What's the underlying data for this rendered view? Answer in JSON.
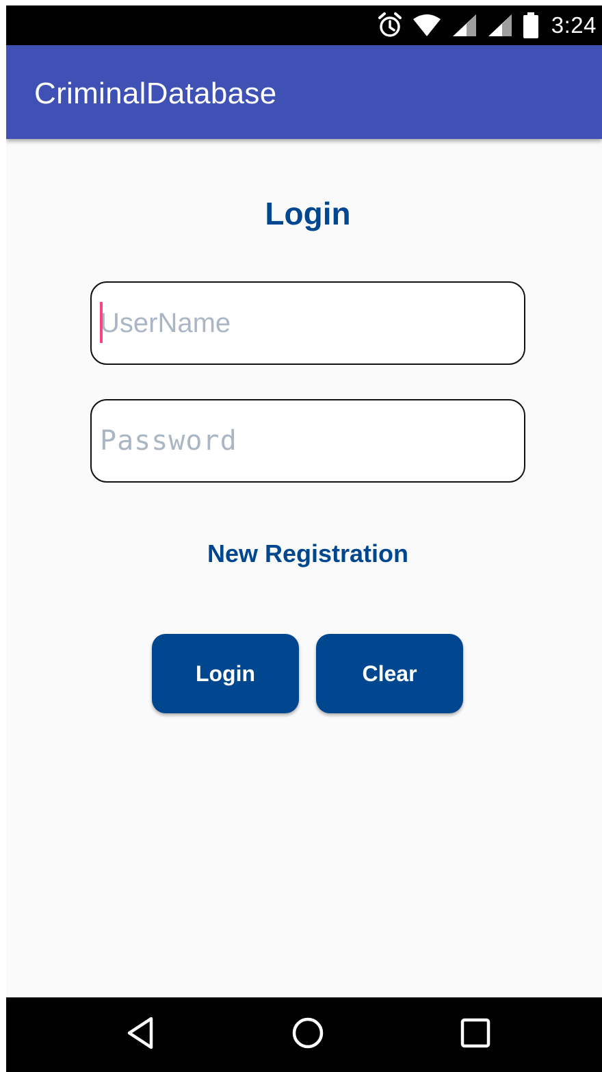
{
  "status_bar": {
    "time": "3:24",
    "icons": [
      "alarm-icon",
      "wifi-icon",
      "signal-icon",
      "signal-icon",
      "battery-icon"
    ]
  },
  "app_bar": {
    "title": "CriminalDatabase"
  },
  "form": {
    "title": "Login",
    "username": {
      "placeholder": "UserName",
      "value": ""
    },
    "password": {
      "placeholder": "Password",
      "value": ""
    },
    "registration_link": "New Registration",
    "login_button": "Login",
    "clear_button": "Clear"
  },
  "nav_bar": {
    "icons": [
      "back-icon",
      "home-icon",
      "recents-icon"
    ]
  },
  "colors": {
    "app_bar": "#3f51b5",
    "accent": "#00478f",
    "caret": "#ff4081",
    "background": "#fafafa"
  }
}
